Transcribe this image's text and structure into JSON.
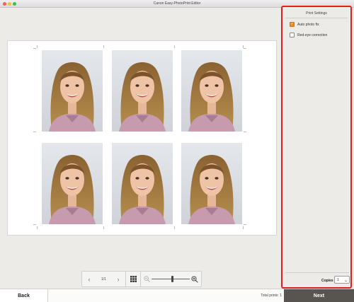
{
  "window": {
    "title": "Canon Easy-PhotoPrint Editor"
  },
  "preview": {
    "photos": [
      {
        "id": "photo-1"
      },
      {
        "id": "photo-2"
      },
      {
        "id": "photo-3"
      },
      {
        "id": "photo-4"
      },
      {
        "id": "photo-5"
      },
      {
        "id": "photo-6"
      }
    ]
  },
  "nav": {
    "prev_icon": "chevron-left-icon",
    "page_indicator": "1/1",
    "next_icon": "chevron-right-icon",
    "grid_icon": "grid-view-icon",
    "zoom_out_icon": "zoom-out-icon",
    "zoom_in_icon": "zoom-in-icon",
    "zoom_level": 0.55
  },
  "panel": {
    "title": "Print Settings",
    "options": [
      {
        "label": "Auto photo fix",
        "checked": true
      },
      {
        "label": "Red-eye correction",
        "checked": false
      }
    ],
    "copies_label": "Copies",
    "copies_value": "1"
  },
  "footer": {
    "back_label": "Back",
    "total_prints": "Total prints: 1",
    "next_label": "Next"
  },
  "colors": {
    "highlight": "#e0201f",
    "checkbox_on": "#ee8a22",
    "next_button": "#585550"
  }
}
